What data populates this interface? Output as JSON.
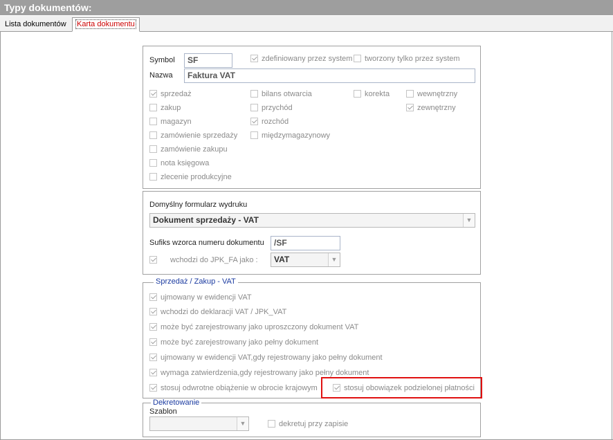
{
  "window": {
    "title": "Typy dokumentów:"
  },
  "tabs": [
    {
      "label": "Lista dokumentów"
    },
    {
      "label": "Karta dokumentu"
    }
  ],
  "general": {
    "symbol_label": "Symbol",
    "symbol_value": "SF",
    "nazwa_label": "Nazwa",
    "nazwa_value": "Faktura VAT",
    "flags": {
      "zdefiniowany": "zdefiniowany przez system",
      "tworzony": "tworzony tylko przez system"
    },
    "types": {
      "sprzedaz": "sprzedaż",
      "zakup": "zakup",
      "magazyn": "magazyn",
      "zam_sprzedazy": "zamówienie sprzedaży",
      "zam_zakupu": "zamówienie zakupu",
      "nota": "nota księgowa",
      "zlecenie": "zlecenie produkcyjne",
      "bilans": "bilans otwarcia",
      "przychod": "przychód",
      "rozchod": "rozchód",
      "miedzymag": "międzymagazynowy",
      "korekta": "korekta",
      "wewnetrzny": "wewnętrzny",
      "zewnetrzny": "zewnętrzny"
    }
  },
  "print": {
    "form_label": "Domyślny formularz wydruku",
    "form_value": "Dokument sprzedaży - VAT",
    "suffix_label": "Sufiks wzorca numeru dokumentu",
    "suffix_value": "/SF",
    "jpk_label": "wchodzi do JPK_FA jako :",
    "jpk_value": "VAT"
  },
  "vat": {
    "legend": "Sprzedaż / Zakup - VAT",
    "items": {
      "ewidencja": "ujmowany w ewidencji VAT",
      "deklaracja": "wchodzi do deklaracji VAT  / JPK_VAT",
      "uproszczony": "może być zarejestrowany jako uproszczony dokument VAT",
      "pelny": "może być zarejestrowany jako pełny dokument",
      "ewid_pelny": "ujmowany w ewidencji VAT,gdy rejestrowany jako pełny dokument",
      "zatwierdzenia": "wymaga zatwierdzenia,gdy rejestrowany jako pełny dokument",
      "odwrotne": "stosuj odwrotne obiążenie w obrocie krajowym",
      "podzielona": "stosuj obowiązek podzielonej płatności"
    }
  },
  "dekretowanie": {
    "legend": "Dekretowanie",
    "szablon_label": "Szablon",
    "szablon_value": "",
    "przy_zapisie": "dekretuj przy zapisie"
  },
  "colors": {
    "highlight": "#e01010",
    "legend_text": "#1a3aa0",
    "titlebar": "#9e9e9e"
  }
}
